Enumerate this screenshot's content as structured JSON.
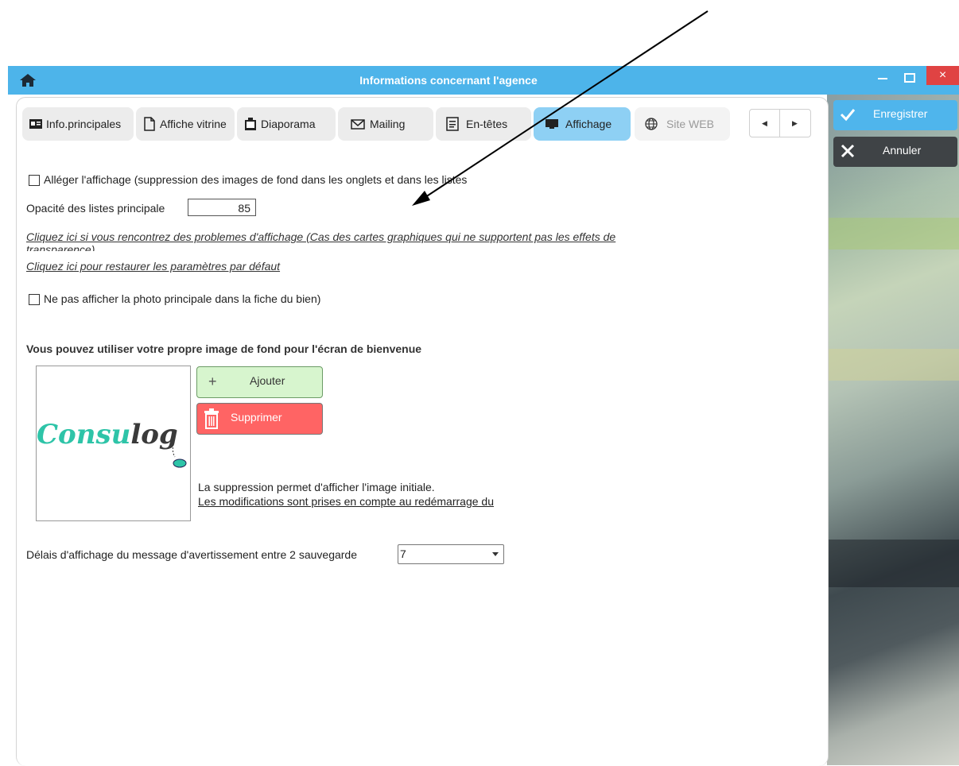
{
  "window": {
    "title": "Informations concernant l'agence",
    "close_glyph": "×"
  },
  "sidebar": {
    "save_label": "Enregistrer",
    "cancel_label": "Annuler"
  },
  "tabs": [
    {
      "label": "Info.principales",
      "icon": "id-card-icon"
    },
    {
      "label": "Affiche vitrine",
      "icon": "document-icon"
    },
    {
      "label": "Diaporama",
      "icon": "slideshow-icon"
    },
    {
      "label": "Mailing",
      "icon": "envelope-icon"
    },
    {
      "label": "En-têtes",
      "icon": "header-icon"
    },
    {
      "label": "Affichage",
      "icon": "monitor-icon",
      "active": true
    },
    {
      "label": "Site WEB",
      "icon": "globe-icon"
    }
  ],
  "content": {
    "lighten_checkbox_label": "Alléger l'affichage (suppression des images de fond dans les onglets et dans les listes",
    "opacity_label": "Opacité des listes principale",
    "opacity_value": "85",
    "graphics_link": "Cliquez ici si vous rencontrez des problemes d'affichage (Cas des cartes graphiques qui ne supportent pas les effets de",
    "graphics_link_cont": "transparence)",
    "restore_link": "Cliquez ici pour restaurer les paramètres par défaut",
    "hide_photo_label": "Ne pas afficher la photo principale dans la fiche du bien)",
    "background_heading": "Vous pouvez utiliser votre propre image de fond pour l'écran de bienvenue",
    "logo_text_a": "Consu",
    "logo_text_b": "log",
    "add_button": "Ajouter",
    "add_glyph": "+",
    "delete_button": "Supprimer",
    "delete_info": "La suppression permet d'afficher l'image initiale.",
    "restart_info": "Les modifications sont prises en compte au redémarrage du",
    "delay_label": "Délais d'affichage du message d'avertissement entre 2 sauvegarde",
    "delay_value": "7"
  },
  "colors": {
    "titlebar": "#4db4ea",
    "save": "#4fb5ec",
    "cancel": "#3f4346",
    "active_tab": "#8ed0f4",
    "add": "#d7f5ce",
    "delete": "#ff6464",
    "logo_teal": "#2ec4a8"
  }
}
